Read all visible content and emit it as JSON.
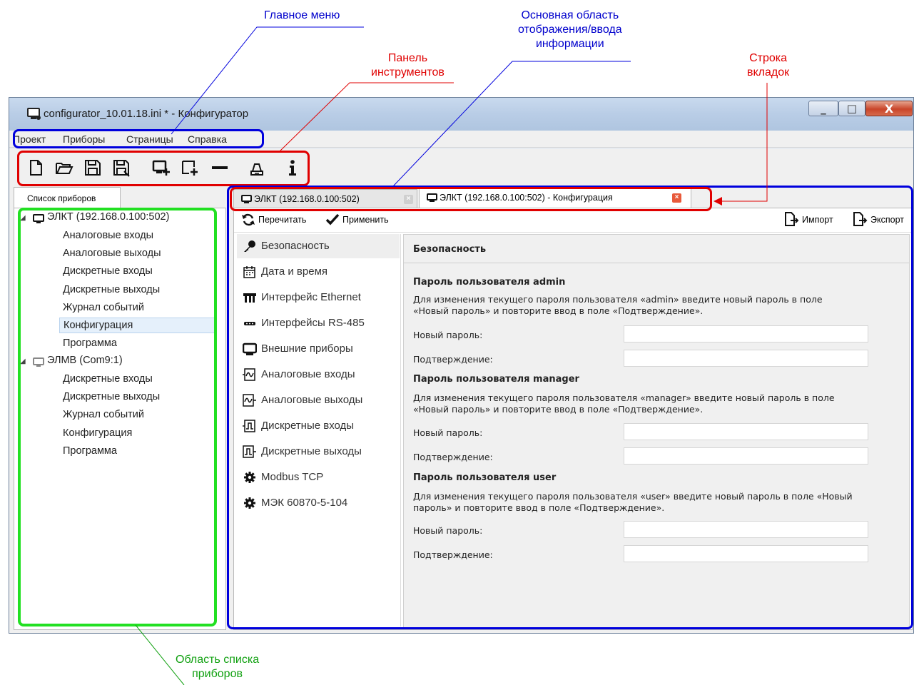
{
  "annotations": {
    "main_menu": "Главное меню",
    "content_area": [
      "Основная область",
      "отображения/ввода",
      "информации"
    ],
    "toolbar": [
      "Панель",
      "инструментов"
    ],
    "tab_row": [
      "Строка",
      "вкладок"
    ],
    "device_list_area": [
      "Область списка",
      "приборов"
    ]
  },
  "window": {
    "title": "configurator_10.01.18.ini * - Конфигуратор",
    "controls": {
      "minimize": "_",
      "maximize": "□",
      "close": "X"
    }
  },
  "menu": [
    "Проект",
    "Приборы",
    "Страницы",
    "Справка"
  ],
  "toolbar_icons": [
    "new-file-icon",
    "open-folder-icon",
    "save-icon",
    "save-as-icon",
    "add-device-icon",
    "add-copy-icon",
    "remove-icon",
    "connect-icon",
    "info-icon"
  ],
  "left_panel": {
    "tab_label": "Список приборов",
    "devices": [
      {
        "name": "ЭЛКТ (192.168.0.100:502)",
        "children": [
          "Аналоговые входы",
          "Аналоговые выходы",
          "Дискретные входы",
          "Дискретные выходы",
          "Журнал событий",
          "Конфигурация",
          "Программа"
        ],
        "selected_child": "Конфигурация"
      },
      {
        "name": "ЭЛМВ (Com9:1)",
        "children": [
          "Дискретные входы",
          "Дискретные выходы",
          "Журнал событий",
          "Конфигурация",
          "Программа"
        ]
      }
    ]
  },
  "tabs": [
    {
      "label": "ЭЛКТ (192.168.0.100:502)",
      "active": false
    },
    {
      "label": "ЭЛКТ (192.168.0.100:502) - Конфигурация",
      "active": true
    }
  ],
  "actions": {
    "reread": "Перечитать",
    "apply": "Применить",
    "import": "Импорт",
    "export": "Экспорт"
  },
  "nav": [
    "Безопасность",
    "Дата и время",
    "Интерфейс Ethernet",
    "Интерфейсы RS-485",
    "Внешние приборы",
    "Аналоговые входы",
    "Аналоговые выходы",
    "Дискретные входы",
    "Дискретные выходы",
    "Modbus TCP",
    "МЭК 60870-5-104"
  ],
  "nav_active": "Безопасность",
  "form": {
    "header": "Безопасность",
    "sections": [
      {
        "title": "Пароль пользователя admin",
        "desc1": "Для изменения текущего пароля пользователя «admin» введите новый пароль в поле",
        "desc2": "«Новый пароль» и повторите ввод в поле «Подтверждение».",
        "new_label": "Новый пароль:",
        "new_value": "",
        "confirm_label": "Подтверждение:",
        "confirm_value": ""
      },
      {
        "title": "Пароль пользователя manager",
        "desc1": "Для изменения текущего пароля пользователя «manager» введите новый пароль в поле",
        "desc2": "«Новый пароль» и повторите ввод в поле «Подтверждение».",
        "new_label": "Новый пароль:",
        "new_value": "",
        "confirm_label": "Подтверждение:",
        "confirm_value": ""
      },
      {
        "title": "Пароль пользователя user",
        "desc1": "Для изменения текущего пароля пользователя «user» введите новый пароль в поле «Новый",
        "desc2": "пароль» и повторите ввод в поле «Подтверждение».",
        "new_label": "Новый пароль:",
        "new_value": "",
        "confirm_label": "Подтверждение:",
        "confirm_value": ""
      }
    ]
  },
  "colors": {
    "blue_annotation": "#0000cc",
    "red_annotation": "#e00000",
    "green_annotation": "#10a010"
  }
}
